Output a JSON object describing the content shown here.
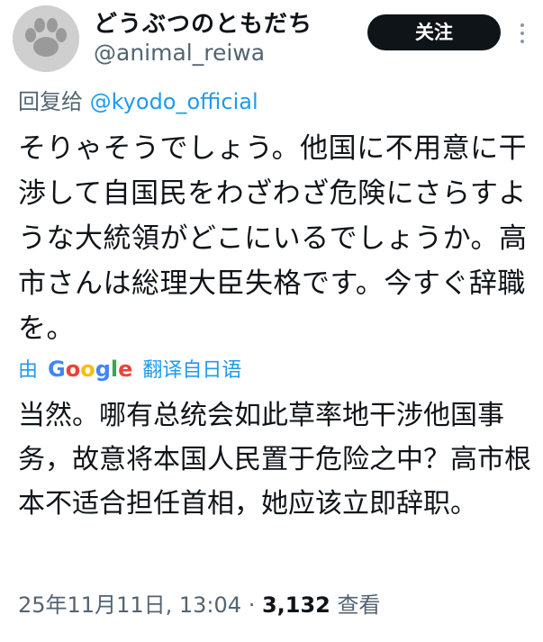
{
  "account": {
    "display_name": "どうぶつのともだち",
    "handle": "@animal_reiwa",
    "follow_label": "关注"
  },
  "reply": {
    "prefix": "回复给",
    "mention": "@kyodo_official"
  },
  "tweet": {
    "text": "そりゃそうでしょう。他国に不用意に干渉して自国民をわざわざ危険にさらすような大統領がどこにいるでしょうか。高市さんは総理大臣失格です。今すぐ辞職を。"
  },
  "translation": {
    "by_label": "由",
    "provider": "Google",
    "action_label": "翻译自日语",
    "text": "当然。哪有总统会如此草率地干涉他国事务，故意将本国人民置于危险之中？高市根本不适合担任首相，她应该立即辞职。"
  },
  "meta": {
    "date": "25年11月11日, 13:04",
    "separator": "·",
    "views_count": "3,132",
    "views_label": "查看"
  },
  "icons": {
    "avatar": "paw-print-icon",
    "more": "more-vertical-icon"
  }
}
